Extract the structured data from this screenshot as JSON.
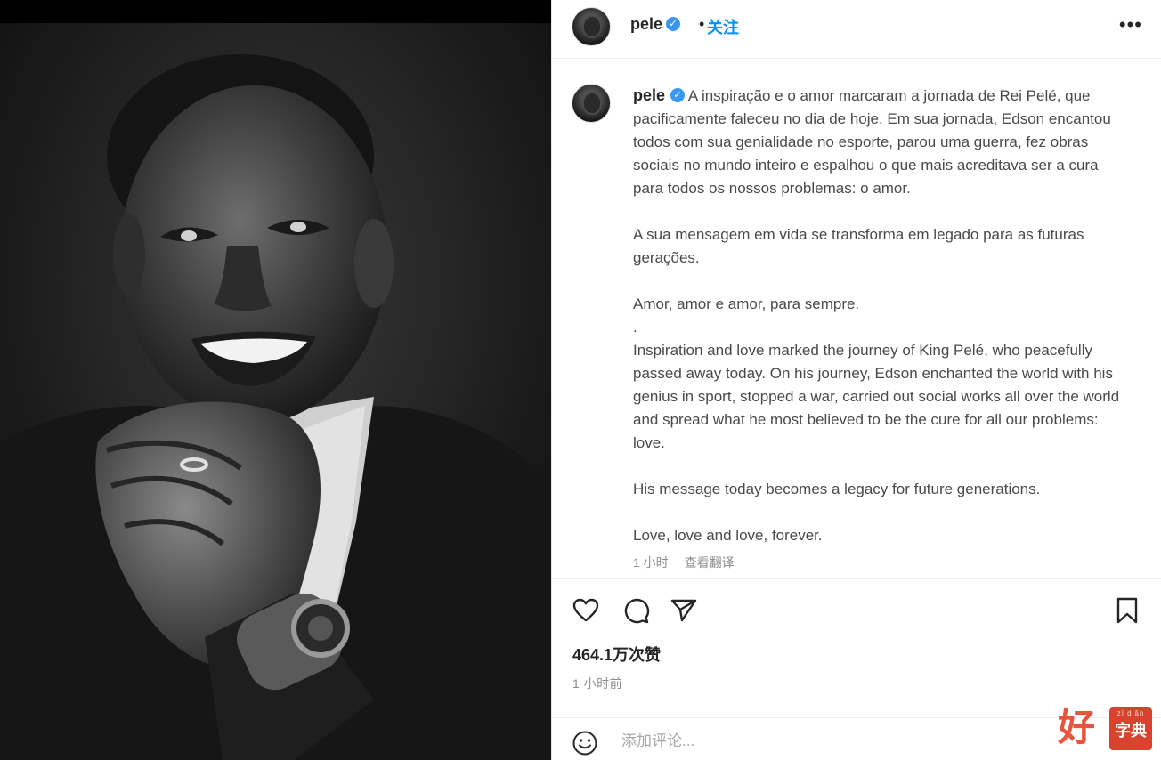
{
  "post": {
    "username": "pele",
    "verified_mark": "✓",
    "separator": "•",
    "follow_label": "关注",
    "more_label": "•••",
    "caption": {
      "paragraphs": [
        "A inspiração e o amor marcaram a jornada de Rei Pelé, que pacificamente faleceu no dia de hoje. Em sua jornada, Edson encantou todos com sua genialidade no esporte, parou uma guerra, fez obras sociais no mundo inteiro e espalhou o que mais acreditava ser a cura para todos os nossos problemas: o amor.",
        "A sua mensagem em vida se transforma em legado para as futuras gerações.",
        "Amor, amor e amor, para sempre.",
        ".",
        "Inspiration and love marked the journey of King Pelé, who peacefully passed away today. On his journey, Edson enchanted the world with his genius in sport, stopped a war, carried out social works all over the world and spread what he most believed to be the cure for all our problems: love.",
        "His message today becomes a legacy for future generations.",
        "Love, love and love, forever."
      ],
      "time_ago": "1 小时",
      "translate_label": "查看翻译"
    },
    "actions": {
      "like_icon": "heart-icon",
      "comment_icon": "comment-icon",
      "share_icon": "send-icon",
      "save_icon": "bookmark-icon"
    },
    "likes_text": "464.1万次赞",
    "posted_time": "1 小时前",
    "comment_placeholder": "添加评论...",
    "emoji_icon": "smiley-icon"
  },
  "photo": {
    "icon": "portrait-photo"
  },
  "watermark": {
    "char": "好",
    "pinyin": "zì diǎn",
    "text": "字典"
  }
}
